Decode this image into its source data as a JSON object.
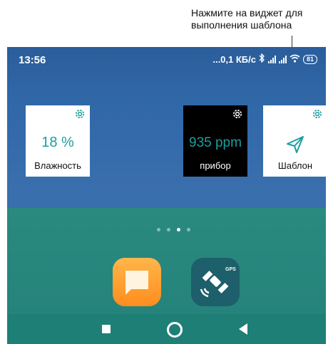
{
  "callout": {
    "line1": "Нажмите на виджет для",
    "line2": "выполнения шаблона"
  },
  "status_bar": {
    "time": "13:56",
    "speed": "...0,1 КБ/с",
    "battery": "81",
    "icons": [
      "bluetooth-icon",
      "signal-icon",
      "signal-icon",
      "wifi-icon",
      "battery-icon"
    ]
  },
  "widgets": [
    {
      "value": "18 %",
      "label": "Влажность",
      "icon": "gear-icon",
      "theme": "white"
    },
    {
      "value": "935 ppm",
      "label": "прибор",
      "icon": "gear-icon",
      "theme": "black"
    },
    {
      "value": "",
      "label": "Шаблон",
      "icon": "send-icon",
      "theme": "white"
    }
  ],
  "pager": {
    "pages": 4,
    "active": 2
  },
  "dock": {
    "apps": [
      {
        "icon": "notes-icon",
        "color": "#ff9f2e"
      },
      {
        "icon": "gps-satellite-icon",
        "badge": "GPS",
        "color": "#1d5f6a"
      }
    ]
  },
  "colors": {
    "accent": "#1b9e9e",
    "wallpaper_top": "#2f66a6",
    "wallpaper_bottom": "#23817a"
  }
}
